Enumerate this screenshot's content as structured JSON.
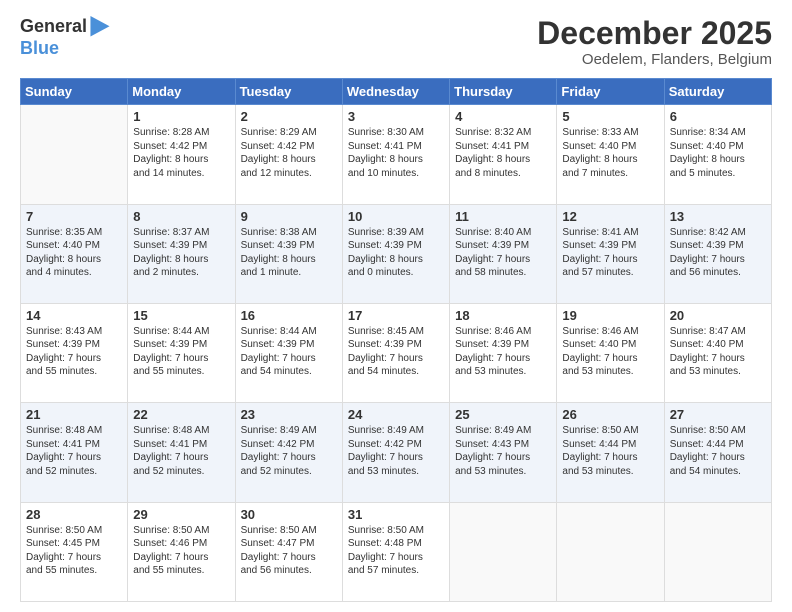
{
  "header": {
    "logo_general": "General",
    "logo_blue": "Blue",
    "month_title": "December 2025",
    "subtitle": "Oedelem, Flanders, Belgium"
  },
  "weekdays": [
    "Sunday",
    "Monday",
    "Tuesday",
    "Wednesday",
    "Thursday",
    "Friday",
    "Saturday"
  ],
  "weeks": [
    [
      {
        "day": "",
        "info": ""
      },
      {
        "day": "1",
        "info": "Sunrise: 8:28 AM\nSunset: 4:42 PM\nDaylight: 8 hours\nand 14 minutes."
      },
      {
        "day": "2",
        "info": "Sunrise: 8:29 AM\nSunset: 4:42 PM\nDaylight: 8 hours\nand 12 minutes."
      },
      {
        "day": "3",
        "info": "Sunrise: 8:30 AM\nSunset: 4:41 PM\nDaylight: 8 hours\nand 10 minutes."
      },
      {
        "day": "4",
        "info": "Sunrise: 8:32 AM\nSunset: 4:41 PM\nDaylight: 8 hours\nand 8 minutes."
      },
      {
        "day": "5",
        "info": "Sunrise: 8:33 AM\nSunset: 4:40 PM\nDaylight: 8 hours\nand 7 minutes."
      },
      {
        "day": "6",
        "info": "Sunrise: 8:34 AM\nSunset: 4:40 PM\nDaylight: 8 hours\nand 5 minutes."
      }
    ],
    [
      {
        "day": "7",
        "info": "Sunrise: 8:35 AM\nSunset: 4:40 PM\nDaylight: 8 hours\nand 4 minutes."
      },
      {
        "day": "8",
        "info": "Sunrise: 8:37 AM\nSunset: 4:39 PM\nDaylight: 8 hours\nand 2 minutes."
      },
      {
        "day": "9",
        "info": "Sunrise: 8:38 AM\nSunset: 4:39 PM\nDaylight: 8 hours\nand 1 minute."
      },
      {
        "day": "10",
        "info": "Sunrise: 8:39 AM\nSunset: 4:39 PM\nDaylight: 8 hours\nand 0 minutes."
      },
      {
        "day": "11",
        "info": "Sunrise: 8:40 AM\nSunset: 4:39 PM\nDaylight: 7 hours\nand 58 minutes."
      },
      {
        "day": "12",
        "info": "Sunrise: 8:41 AM\nSunset: 4:39 PM\nDaylight: 7 hours\nand 57 minutes."
      },
      {
        "day": "13",
        "info": "Sunrise: 8:42 AM\nSunset: 4:39 PM\nDaylight: 7 hours\nand 56 minutes."
      }
    ],
    [
      {
        "day": "14",
        "info": "Sunrise: 8:43 AM\nSunset: 4:39 PM\nDaylight: 7 hours\nand 55 minutes."
      },
      {
        "day": "15",
        "info": "Sunrise: 8:44 AM\nSunset: 4:39 PM\nDaylight: 7 hours\nand 55 minutes."
      },
      {
        "day": "16",
        "info": "Sunrise: 8:44 AM\nSunset: 4:39 PM\nDaylight: 7 hours\nand 54 minutes."
      },
      {
        "day": "17",
        "info": "Sunrise: 8:45 AM\nSunset: 4:39 PM\nDaylight: 7 hours\nand 54 minutes."
      },
      {
        "day": "18",
        "info": "Sunrise: 8:46 AM\nSunset: 4:39 PM\nDaylight: 7 hours\nand 53 minutes."
      },
      {
        "day": "19",
        "info": "Sunrise: 8:46 AM\nSunset: 4:40 PM\nDaylight: 7 hours\nand 53 minutes."
      },
      {
        "day": "20",
        "info": "Sunrise: 8:47 AM\nSunset: 4:40 PM\nDaylight: 7 hours\nand 53 minutes."
      }
    ],
    [
      {
        "day": "21",
        "info": "Sunrise: 8:48 AM\nSunset: 4:41 PM\nDaylight: 7 hours\nand 52 minutes."
      },
      {
        "day": "22",
        "info": "Sunrise: 8:48 AM\nSunset: 4:41 PM\nDaylight: 7 hours\nand 52 minutes."
      },
      {
        "day": "23",
        "info": "Sunrise: 8:49 AM\nSunset: 4:42 PM\nDaylight: 7 hours\nand 52 minutes."
      },
      {
        "day": "24",
        "info": "Sunrise: 8:49 AM\nSunset: 4:42 PM\nDaylight: 7 hours\nand 53 minutes."
      },
      {
        "day": "25",
        "info": "Sunrise: 8:49 AM\nSunset: 4:43 PM\nDaylight: 7 hours\nand 53 minutes."
      },
      {
        "day": "26",
        "info": "Sunrise: 8:50 AM\nSunset: 4:44 PM\nDaylight: 7 hours\nand 53 minutes."
      },
      {
        "day": "27",
        "info": "Sunrise: 8:50 AM\nSunset: 4:44 PM\nDaylight: 7 hours\nand 54 minutes."
      }
    ],
    [
      {
        "day": "28",
        "info": "Sunrise: 8:50 AM\nSunset: 4:45 PM\nDaylight: 7 hours\nand 55 minutes."
      },
      {
        "day": "29",
        "info": "Sunrise: 8:50 AM\nSunset: 4:46 PM\nDaylight: 7 hours\nand 55 minutes."
      },
      {
        "day": "30",
        "info": "Sunrise: 8:50 AM\nSunset: 4:47 PM\nDaylight: 7 hours\nand 56 minutes."
      },
      {
        "day": "31",
        "info": "Sunrise: 8:50 AM\nSunset: 4:48 PM\nDaylight: 7 hours\nand 57 minutes."
      },
      {
        "day": "",
        "info": ""
      },
      {
        "day": "",
        "info": ""
      },
      {
        "day": "",
        "info": ""
      }
    ]
  ]
}
